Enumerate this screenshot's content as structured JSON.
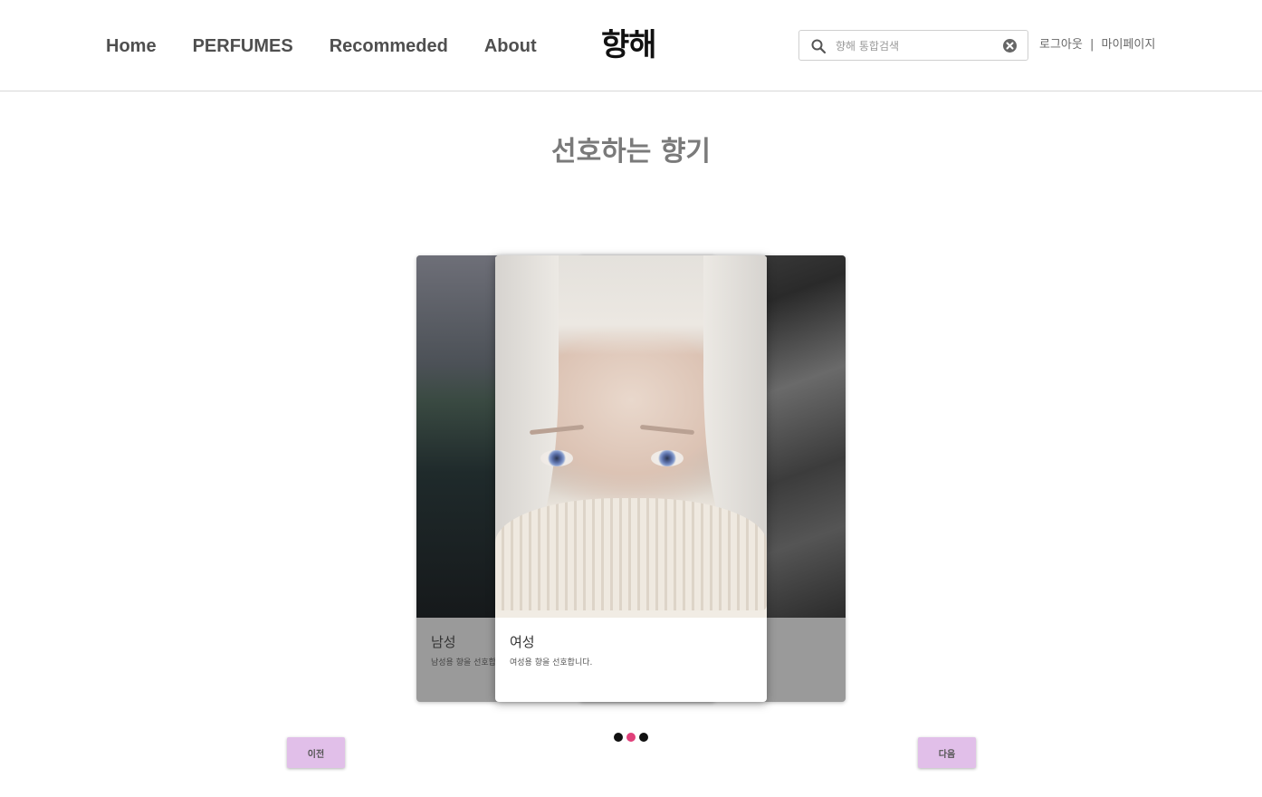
{
  "header": {
    "nav": [
      "Home",
      "PERFUMES",
      "Recommeded",
      "About"
    ],
    "logo": "향해",
    "search": {
      "placeholder": "향해 통합검색",
      "icon": "search-icon",
      "clear_icon": "clear-icon"
    },
    "account": {
      "logout": "로그아웃",
      "separator": "|",
      "mypage": "마이페이지"
    }
  },
  "main": {
    "title": "선호하는 향기",
    "cards": [
      {
        "caption": "남성",
        "description": "남성용 향을 선호합니다."
      },
      {
        "caption": "여성",
        "description": "여성용 향을 선호합니다."
      },
      {
        "caption": "",
        "description": ""
      }
    ],
    "pagination": {
      "count": 3,
      "active_index": 1,
      "active_color": "#e0407a"
    },
    "buttons": {
      "prev": "이전",
      "next": "다음"
    }
  },
  "colors": {
    "button_bg": "#e1bfe9",
    "title": "#7a7a7a"
  }
}
